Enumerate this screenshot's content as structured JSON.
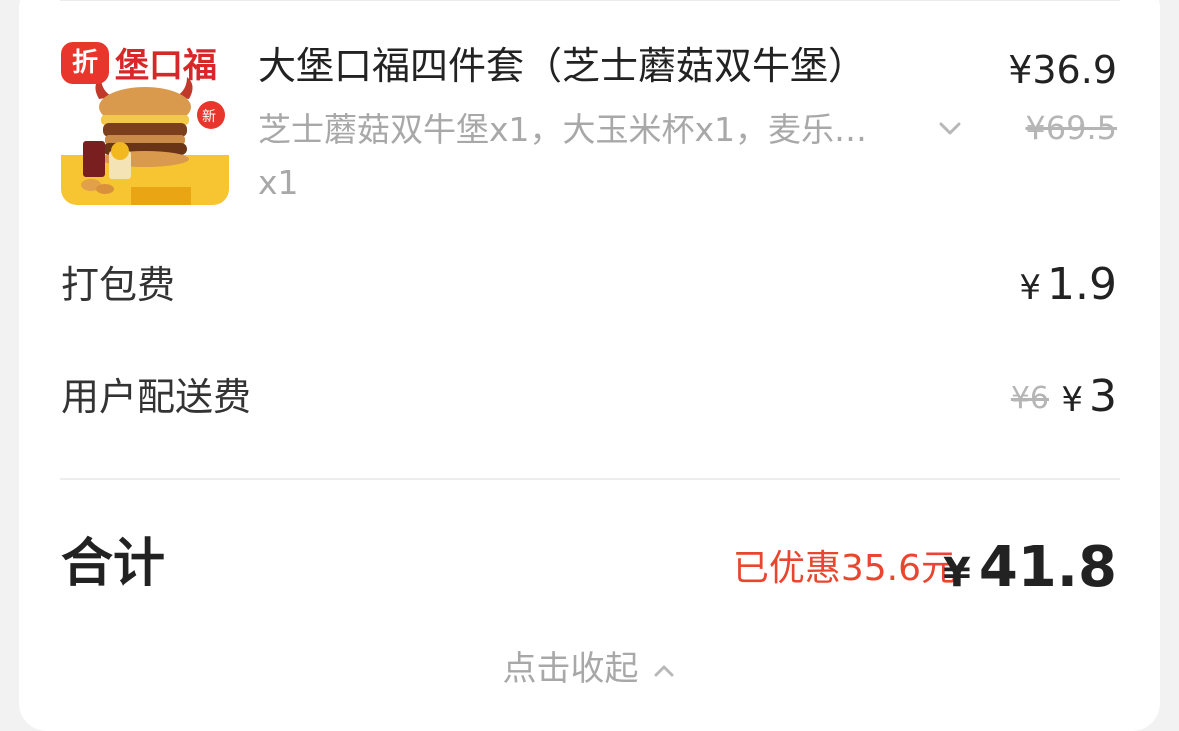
{
  "product": {
    "discount_tag": "折",
    "image_brand_text": "堡口福",
    "image_new_badge": "新",
    "title": "大堡口福四件套（芝士蘑菇双牛堡）",
    "description": "芝士蘑菇双牛堡x1，大玉米杯x1，麦乐…",
    "quantity": "x1",
    "price_current": "¥36.9",
    "price_original": "¥69.5"
  },
  "fees": {
    "packing_label": "打包费",
    "packing_currency": "¥",
    "packing_value": "1.9",
    "delivery_label": "用户配送费",
    "delivery_original": "¥6",
    "delivery_currency": "¥",
    "delivery_value": "3"
  },
  "total": {
    "label": "合计",
    "discount_note": "已优惠35.6元",
    "currency": "¥",
    "value": "41.8"
  },
  "collapse_label": "点击收起",
  "colors": {
    "accent_red": "#e8462f",
    "tag_red": "#e8362d",
    "muted_gray": "#a8a8a8"
  },
  "icons": {
    "expand": "chevron-down-icon",
    "collapse": "chevron-up-icon"
  }
}
